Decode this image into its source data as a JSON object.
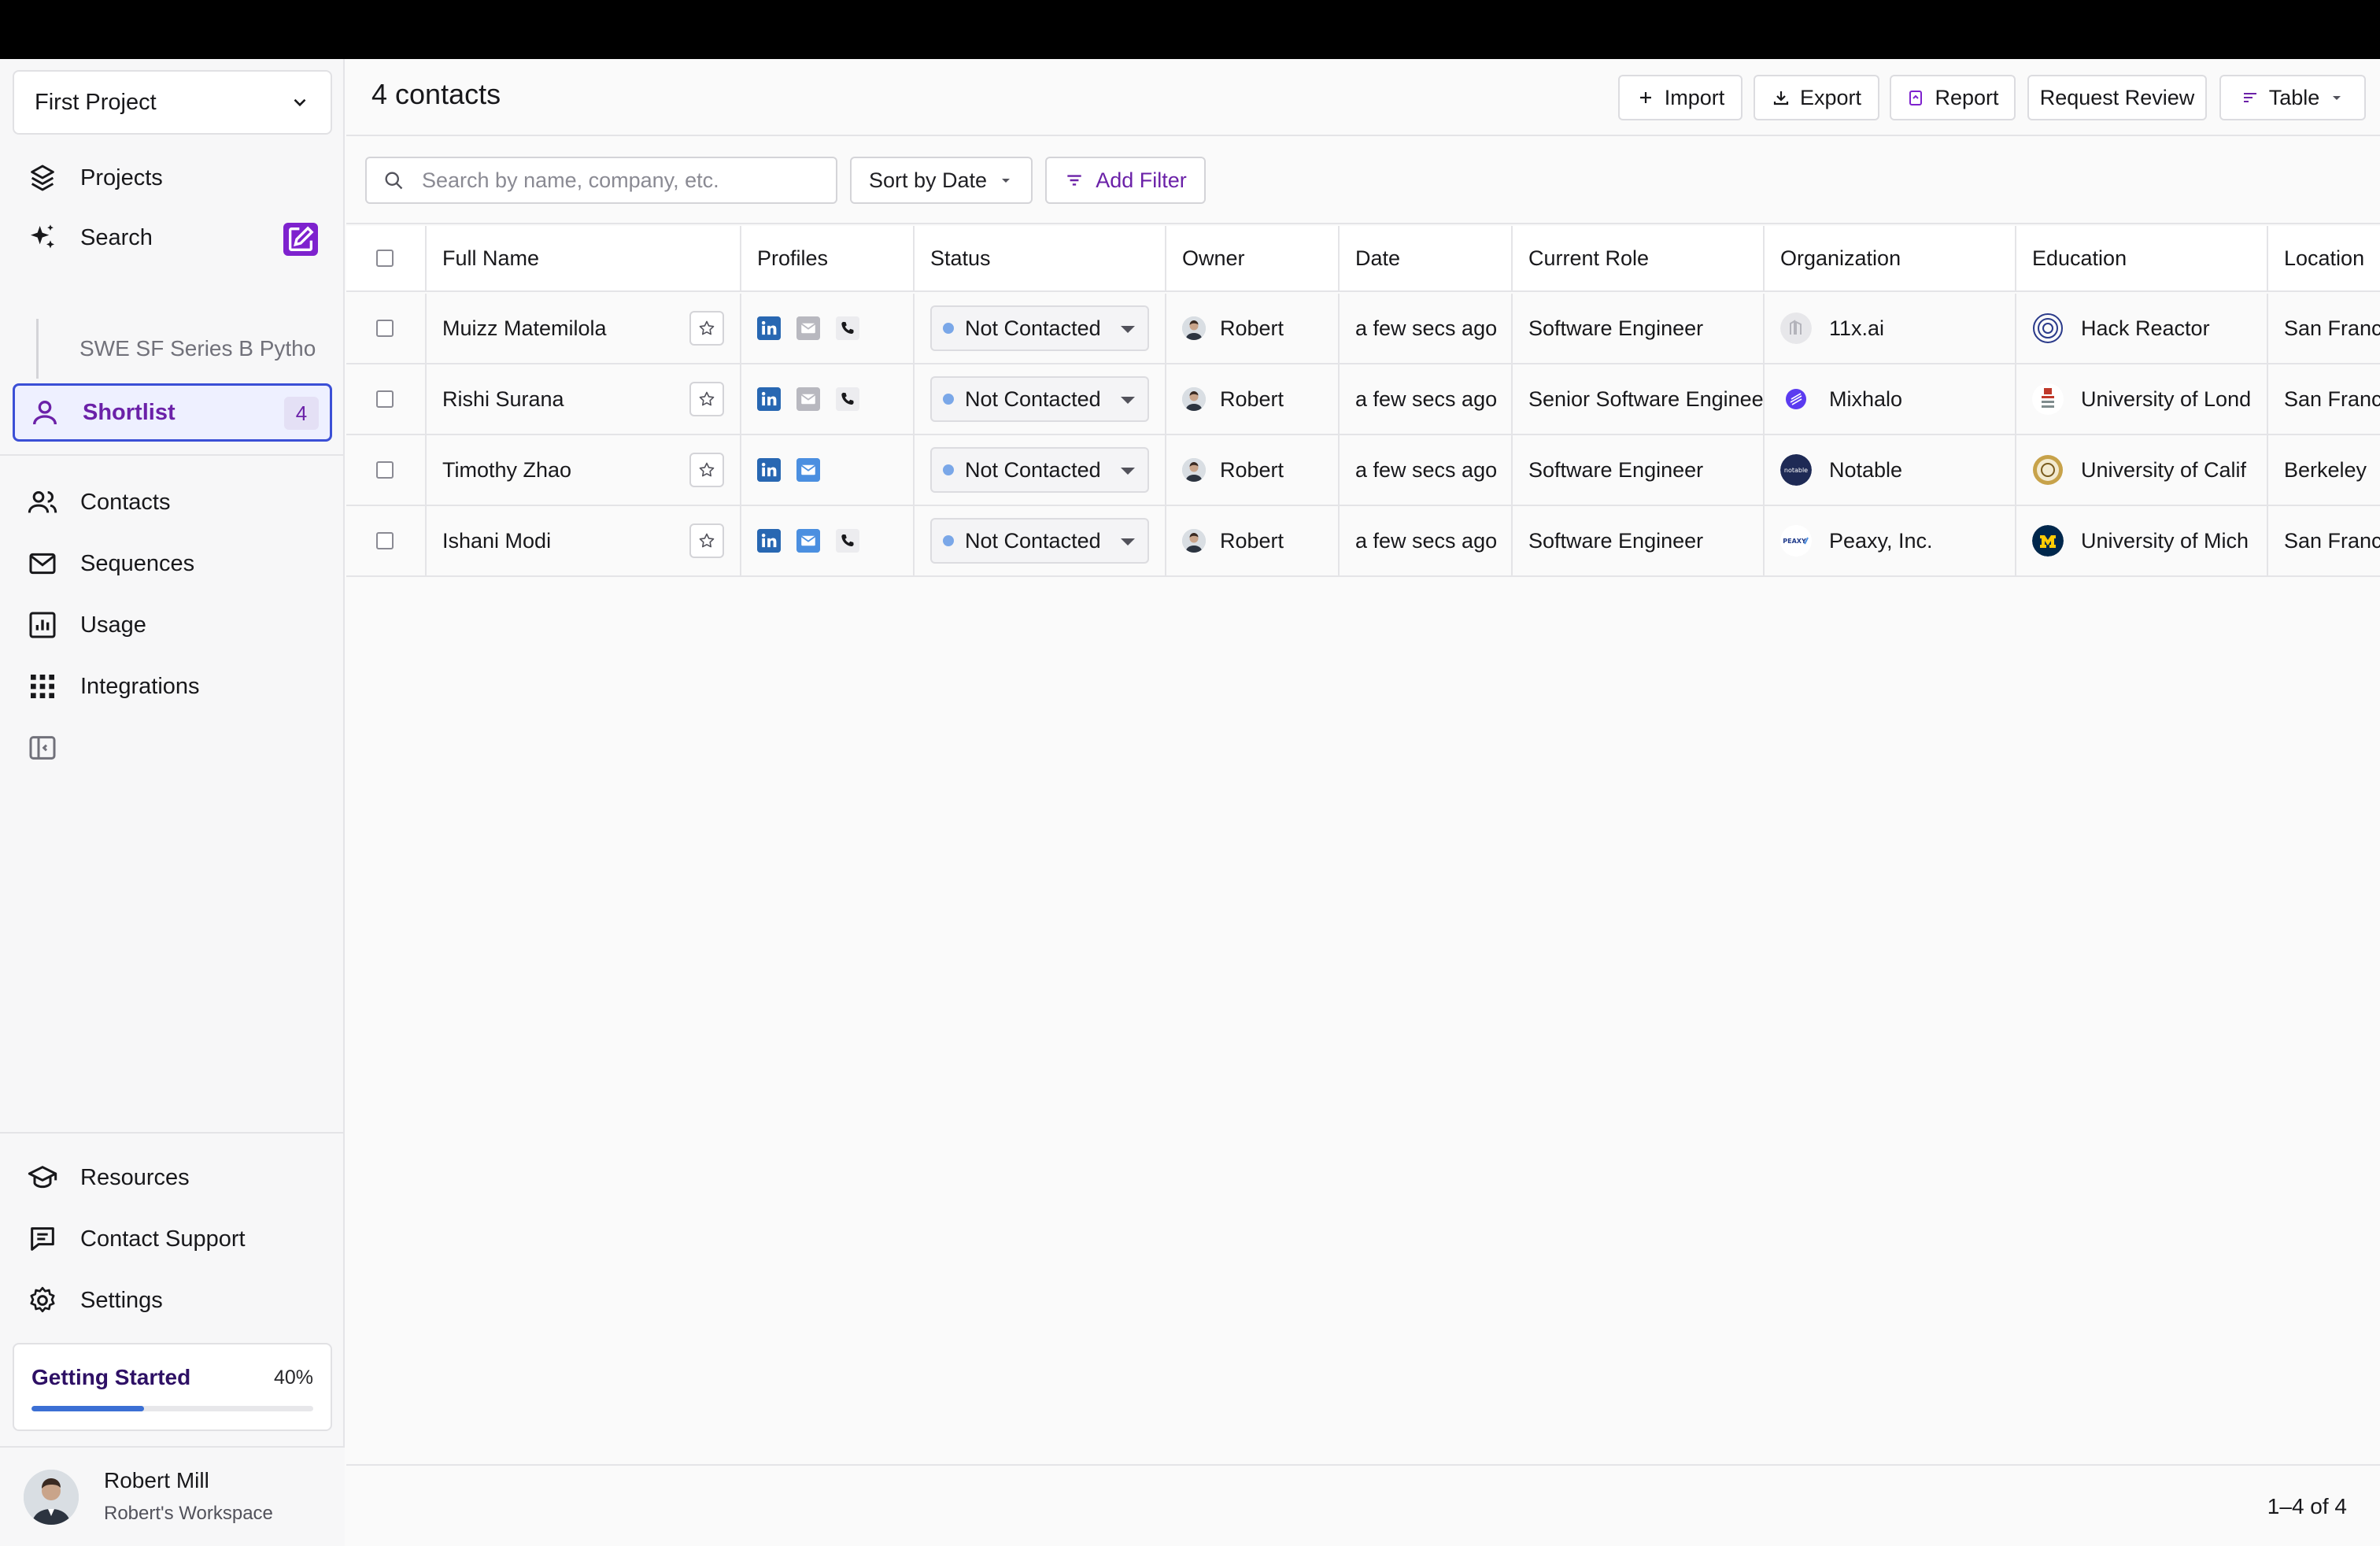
{
  "sidebar": {
    "project_select": "First Project",
    "nav": {
      "projects": "Projects",
      "search": "Search",
      "search_sub": "SWE SF Series B Pytho",
      "shortlist": "Shortlist",
      "shortlist_count": "4",
      "contacts": "Contacts",
      "sequences": "Sequences",
      "usage": "Usage",
      "integrations": "Integrations",
      "resources": "Resources",
      "contact_support": "Contact Support",
      "settings": "Settings"
    },
    "getting_started": {
      "label": "Getting Started",
      "percent_text": "40%",
      "progress": 0.4
    },
    "user": {
      "name": "Robert Mill",
      "workspace": "Robert's Workspace"
    }
  },
  "header": {
    "title": "4 contacts",
    "buttons": {
      "import": "Import",
      "export": "Export",
      "report": "Report",
      "request_review": "Request Review",
      "view": "Table"
    }
  },
  "filters": {
    "search_placeholder": "Search by name, company, etc.",
    "sort": "Sort by Date",
    "add_filter": "Add Filter"
  },
  "table": {
    "columns": [
      "Full Name",
      "Profiles",
      "Status",
      "Owner",
      "Date",
      "Current Role",
      "Organization",
      "Education",
      "Location"
    ],
    "rows": [
      {
        "name": "Muizz Matemilola",
        "status": "Not Contacted",
        "owner": "Robert",
        "date": "a few secs ago",
        "role": "Software Engineer",
        "org": "11x.ai",
        "edu": "Hack Reactor",
        "loc": "San Franc",
        "profiles": [
          "linkedin",
          "email-gray",
          "phone"
        ]
      },
      {
        "name": "Rishi Surana",
        "status": "Not Contacted",
        "owner": "Robert",
        "date": "a few secs ago",
        "role": "Senior Software Enginee",
        "org": "Mixhalo",
        "edu": "University of Lond",
        "loc": "San Franc",
        "profiles": [
          "linkedin",
          "email-gray",
          "phone"
        ]
      },
      {
        "name": "Timothy Zhao",
        "status": "Not Contacted",
        "owner": "Robert",
        "date": "a few secs ago",
        "role": "Software Engineer",
        "org": "Notable",
        "edu": "University of Calif",
        "loc": "Berkeley",
        "profiles": [
          "linkedin",
          "email-blue"
        ]
      },
      {
        "name": "Ishani Modi",
        "status": "Not Contacted",
        "owner": "Robert",
        "date": "a few secs ago",
        "role": "Software Engineer",
        "org": "Peaxy, Inc.",
        "edu": "University of Mich",
        "loc": "San Franc",
        "profiles": [
          "linkedin",
          "email-blue",
          "phone"
        ]
      }
    ]
  },
  "footer": {
    "pagination": "1–4 of 4"
  },
  "colors": {
    "accent": "#7e22ce",
    "shortlist_border": "#3b4fd6",
    "linkedin": "#2867b2",
    "status_dot": "#7aa7e8"
  }
}
